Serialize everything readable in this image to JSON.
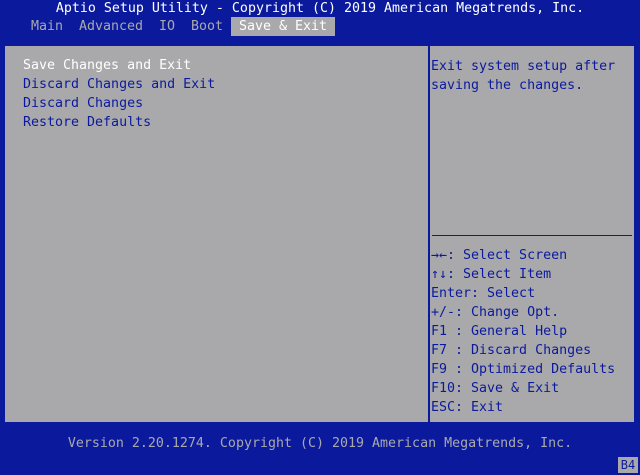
{
  "title": "Aptio Setup Utility - Copyright (C) 2019 American Megatrends, Inc.",
  "menu": [
    {
      "label": "Main"
    },
    {
      "label": "Advanced"
    },
    {
      "label": "IO"
    },
    {
      "label": "Boot"
    },
    {
      "label": "Save & Exit"
    }
  ],
  "options": [
    {
      "label": "Save Changes and Exit"
    },
    {
      "label": "Discard Changes and Exit"
    },
    {
      "label": "Discard Changes"
    },
    {
      "label": "Restore Defaults"
    }
  ],
  "help_text": "Exit system setup after saving the changes.",
  "keys": [
    {
      "label": "→←: Select Screen"
    },
    {
      "label": "↑↓: Select Item"
    },
    {
      "label": "Enter: Select"
    },
    {
      "label": "+/-: Change Opt."
    },
    {
      "label": "F1 : General Help"
    },
    {
      "label": "F7 : Discard Changes"
    },
    {
      "label": "F9 : Optimized Defaults"
    },
    {
      "label": "F10: Save & Exit"
    },
    {
      "label": "ESC: Exit"
    }
  ],
  "footer": "Version 2.20.1274. Copyright (C) 2019 American Megatrends, Inc.",
  "badge": "B4",
  "colors": {
    "background": "#0b1a9c",
    "panel": "#a9a9ab",
    "highlight_text": "#ffffff",
    "text": "#0b1a9c"
  }
}
